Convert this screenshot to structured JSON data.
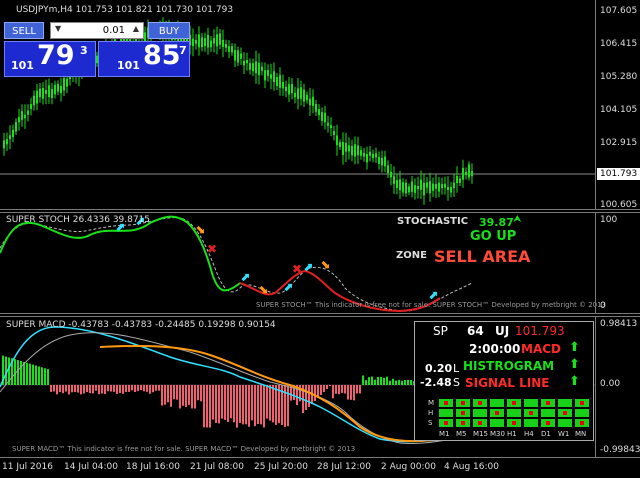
{
  "main_chart": {
    "title": "USDJPYm,H4  101.753 101.821 101.730 101.793",
    "price_ticks": [
      "107.605",
      "106.415",
      "105.280",
      "104.105",
      "102.915",
      "100.605"
    ],
    "current_price": "101.793"
  },
  "trade_panel": {
    "sell_label": "SELL",
    "buy_label": "BUY",
    "lot": "0.01",
    "sell_prefix": "101",
    "sell_big": "79",
    "sell_sup": "3",
    "buy_prefix": "101",
    "buy_big": "85",
    "buy_sup": "7"
  },
  "stoch": {
    "title": "SUPER STOCH 26.4336 39.8715",
    "axis_top": "100",
    "axis_bottom": "0",
    "stochastic_label": "STOCHASTIC",
    "stochastic_value": "39.87",
    "go_up": "GO UP",
    "zone_label": "ZONE",
    "zone_value": "SELL AREA",
    "footer": "SUPER STOCH™ This indicator is free not for sale. SUPER STOCH™ Developed by metbright © 2013"
  },
  "macd": {
    "title": "SUPER MACD -0.43783 -0.43783 -0.24485 0.19298 0.90154",
    "axis_top": "0.98413",
    "axis_zero": "0.00",
    "axis_bottom": "-0.99843",
    "footer": "SUPER MACD™ This indicator is free not for sale. SUPER MACD™ Developed by metbright © 2013"
  },
  "dashboard": {
    "sp_label": "SP",
    "sp_value": "64",
    "pair_label": "UJ",
    "pair_price": "101.793",
    "time": "2:00:00",
    "macd_label": "MACD",
    "histo_label": "HISTROGRAM",
    "signal_label": "SIGNAL LINE",
    "v1": "0.20",
    "v1_unit": "L",
    "v2": "-2.48",
    "v2_unit": "S",
    "row_labels": [
      "M",
      "H",
      "S"
    ],
    "timeframes": [
      "M1",
      "M5",
      "M15",
      "M30",
      "H1",
      "H4",
      "D1",
      "W1",
      "MN"
    ]
  },
  "time_axis": [
    "11 Jul 2016",
    "14 Jul 04:00",
    "18 Jul 16:00",
    "21 Jul 08:00",
    "25 Jul 20:00",
    "28 Jul 12:00",
    "2 Aug 00:00",
    "4 Aug 16:00"
  ],
  "colors": {
    "bull": "#19e019",
    "bear": "#e02020",
    "orange": "#ff9a10",
    "cyan": "#30e0ff",
    "blue": "#1c2ad0"
  }
}
